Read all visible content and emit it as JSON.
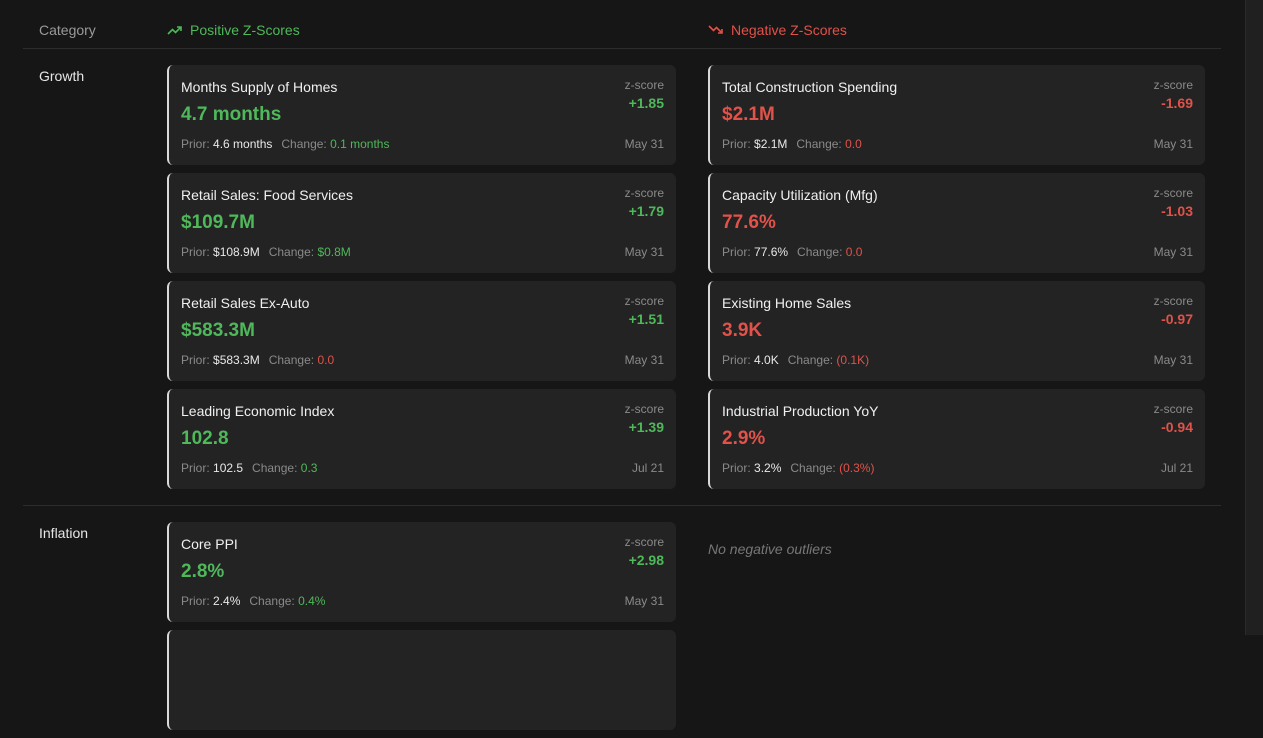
{
  "header": {
    "category": "Category",
    "positive": "Positive Z-Scores",
    "negative": "Negative Z-Scores"
  },
  "labels": {
    "zscore": "z-score",
    "prior": "Prior:",
    "change": "Change:",
    "no_negative": "No negative outliers"
  },
  "colors": {
    "positive": "#4fb85a",
    "negative": "#e0524a"
  },
  "sections": [
    {
      "name": "Growth",
      "positive": [
        {
          "title": "Months Supply of Homes",
          "value": "4.7 months",
          "z": "+1.85",
          "prior": "4.6 months",
          "change": "0.1 months",
          "date": "May 31"
        },
        {
          "title": "Retail Sales: Food Services",
          "value": "$109.7M",
          "z": "+1.79",
          "prior": "$108.9M",
          "change": "$0.8M",
          "date": "May 31"
        },
        {
          "title": "Retail Sales Ex-Auto",
          "value": "$583.3M",
          "z": "+1.51",
          "prior": "$583.3M",
          "change": "0.0",
          "date": "May 31"
        },
        {
          "title": "Leading Economic Index",
          "value": "102.8",
          "z": "+1.39",
          "prior": "102.5",
          "change": "0.3",
          "date": "Jul 21"
        }
      ],
      "negative": [
        {
          "title": "Total Construction Spending",
          "value": "$2.1M",
          "z": "-1.69",
          "prior": "$2.1M",
          "change": "0.0",
          "date": "May 31"
        },
        {
          "title": "Capacity Utilization (Mfg)",
          "value": "77.6%",
          "z": "-1.03",
          "prior": "77.6%",
          "change": "0.0",
          "date": "May 31"
        },
        {
          "title": "Existing Home Sales",
          "value": "3.9K",
          "z": "-0.97",
          "prior": "4.0K",
          "change": "(0.1K)",
          "date": "May 31"
        },
        {
          "title": "Industrial Production YoY",
          "value": "2.9%",
          "z": "-0.94",
          "prior": "3.2%",
          "change": "(0.3%)",
          "date": "Jul 21"
        }
      ]
    },
    {
      "name": "Inflation",
      "positive": [
        {
          "title": "Core PPI",
          "value": "2.8%",
          "z": "+2.98",
          "prior": "2.4%",
          "change": "0.4%",
          "date": "May 31"
        }
      ],
      "negative": []
    }
  ]
}
